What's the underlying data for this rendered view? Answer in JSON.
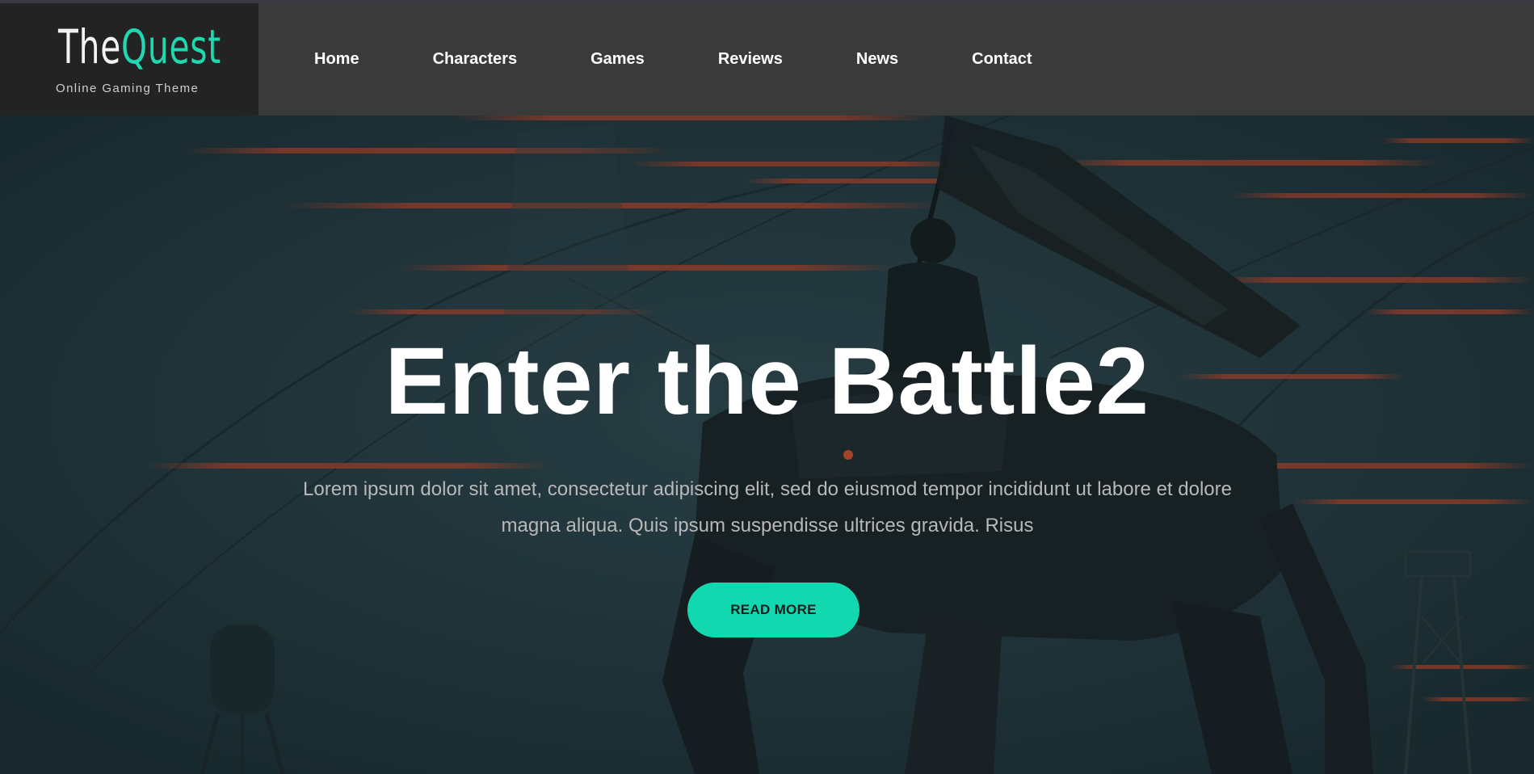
{
  "brand": {
    "title_part1": "The",
    "title_part2": "Quest",
    "tagline": "Online Gaming Theme"
  },
  "nav": {
    "items": [
      {
        "label": "Home"
      },
      {
        "label": "Characters"
      },
      {
        "label": "Games"
      },
      {
        "label": "Reviews"
      },
      {
        "label": "News"
      },
      {
        "label": "Contact"
      }
    ]
  },
  "hero": {
    "title": "Enter the Battle2",
    "text": "Lorem ipsum dolor sit amet, consectetur adipiscing elit, sed do eiusmod tempor incididunt ut labore et dolore magna aliqua. Quis ipsum suspendisse ultrices gravida. Risus",
    "button_label": "READ MORE"
  },
  "colors": {
    "accent": "#12d8b0",
    "nav_bg": "#3a3a3a",
    "logo_bg": "#232323"
  }
}
